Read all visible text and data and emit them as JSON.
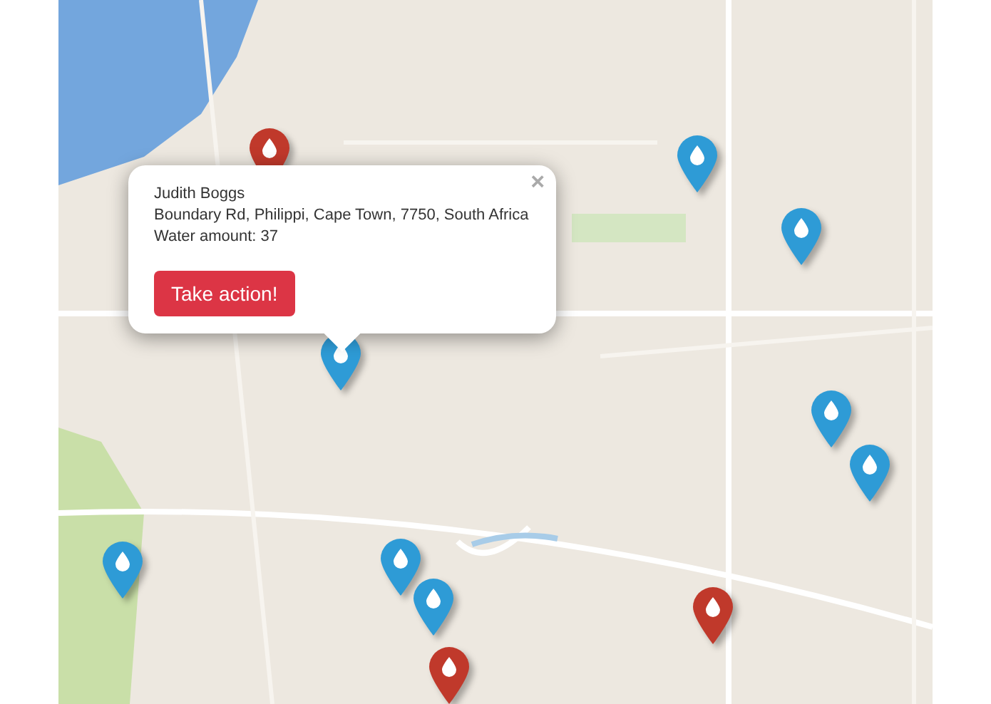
{
  "markers": [
    {
      "color": "#c0392b"
    },
    {
      "color": "#2e9bd6"
    },
    {
      "color": "#2e9bd6"
    },
    {
      "color": "#2e9bd6"
    },
    {
      "color": "#2e9bd6"
    },
    {
      "color": "#2e9bd6"
    },
    {
      "color": "#2e9bd6"
    },
    {
      "color": "#2e9bd6"
    },
    {
      "color": "#2e9bd6"
    },
    {
      "color": "#c0392b"
    },
    {
      "color": "#c0392b"
    }
  ],
  "popup": {
    "close": "×",
    "name": "Judith Boggs",
    "address": "Boundary Rd, Philippi, Cape Town, 7750, South Africa",
    "water": "Water amount: 37",
    "button": "Take action!"
  }
}
